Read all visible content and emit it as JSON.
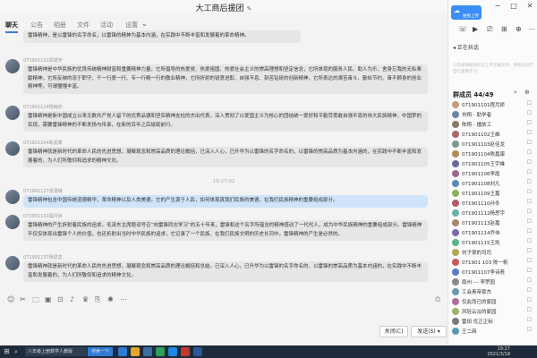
{
  "window": {
    "title": "大工商后援团",
    "edit_icon": "✎",
    "min": "—",
    "max": "□",
    "close": "✕"
  },
  "tabs": [
    {
      "label": "聊天",
      "active": true
    },
    {
      "label": "公告"
    },
    {
      "label": "相册"
    },
    {
      "label": "文件"
    },
    {
      "label": "活动"
    },
    {
      "label": "设置"
    }
  ],
  "tab_more": "⌄",
  "chat": {
    "top_partial": "雷锋精神，是以雷锋的名字命名，以雷锋的精神为基本内涵，在实践中不断丰富和发展着的革命精神。",
    "messages": [
      {
        "name": "071901132郑诺宇",
        "text": "雷锋精神是中华民族的优良传统精神财富和重要精神力量，它所倡导的热爱党、热爱祖国、热爱社会主义的崇高理想和坚定信念，它所体现的服务人民、助人为乐、舍身忘我的无私奉献精神，它所反映的忠于职守、干一行爱一行、专一行精一行的敬业精神，它所折射的锐意进取、自强不息、刻苦钻研的创新精神，它所表达的艰苦奋斗、勤俭节约、奋不顾身的创业精神等，可谓懂懂丰富。"
      },
      {
        "name": "071901124杨雨欣",
        "text": "雷锋精神是新中国成立以来无数共产党人留下的优秀品德和坚实精神支柱的杰出代表。深入贯彻了以爱国主义为核心的团结统一爱好和平勤劳勇敢自强不息的伟大民族精神，中国梦的实现，需要雷锋精神的不断发扬与传承，在新的百年之后砥砺前行。"
      },
      {
        "name": "071901104陈嘉康",
        "text": "雷锋精神就是新时代的革命人民的先进思想，凝聚观念和崇高品质的理论概括，已深入人心，已升华为以雷锋的名字命名的，以雷锋的崇高品质为基本内涵的，在实践中不断丰富和发展着的，为人们所敬仰和追求的精神文化。"
      }
    ],
    "timestamp": "19:27:02",
    "messages2": [
      {
        "name": "071901127张潇璐",
        "text": "雷锋精神包含中国传统道德精华，革命精神以及人类美德，它的产生源于人民，如何体现真我们民族的美德，在我们民族精神的重要组成部分。",
        "highlight": true
      },
      {
        "name": "071901101程月娇",
        "text": "雷锋精神的产生折射着民族的追求。毛泽东主席题词号召“向雷锋同志学习”的五十年来，雷锋和这个名字所蕴含的精神感动了一代代人，成为中华民族精神的重要组成部分。雷锋精神不仅仅体现出雷锋个人的价值，也还折射出当时中华民族的追求，它记录了一个民族、在我们民族文明的历史长河中，雷锋精神的产生是必然的。"
      },
      {
        "name": "071901137杨思蕊",
        "text": "雷锋精神就是新时代的革命人民的先进思想，凝聚观念和崇高品质的理论概括和总结。已深入人心，已升华为以雷锋的名字命名的，以雷锋的崇高品质为基本内涵的，在实践中不断丰富和发展着的，为人们所敬仰和追求的精神文化。"
      }
    ]
  },
  "toolbar": {
    "icons": [
      "smiley-icon",
      "scissors-icon",
      "folder-icon",
      "image-icon",
      "gift-icon",
      "mic-icon",
      "crown-icon",
      "screen-share-icon",
      "shake-icon",
      "more-icon"
    ],
    "glyphs": [
      "☺",
      "✂",
      "🗀",
      "▣",
      "⊡",
      "♪",
      "♛",
      "⎘",
      "✺",
      "⋯"
    ],
    "history": "⏲"
  },
  "buttons": {
    "close": "关闭(C)",
    "send": "发送(S)",
    "send_arrow": "▾"
  },
  "sidebar": {
    "upload_label": "拍照上传",
    "upload_icon": "☁",
    "top_icons": [
      "−",
      "□",
      "✕"
    ],
    "speaking": "正在共话",
    "notice": "七年级课程资料已上传至群文件，请各位同学自行查看学习",
    "members_title": "群成员 44/49",
    "members": [
      {
        "name": "071901101程月娇",
        "color": "#c79b7a"
      },
      {
        "name": "刘翔 - 助学者",
        "color": "#6b86a5"
      },
      {
        "name": "陈翔 - 播放工",
        "color": "#8a7a6a"
      },
      {
        "name": "071901102王维",
        "color": "#a56b6b"
      },
      {
        "name": "071901103赵佳龙",
        "color": "#7a9a8a"
      },
      {
        "name": "071901104陈嘉康",
        "color": "#b38a5a"
      },
      {
        "name": "071901105王宇峰",
        "color": "#6a6a9a"
      },
      {
        "name": "071901106李霞",
        "color": "#9a6a8a"
      },
      {
        "name": "071901108刘凡",
        "color": "#5a8ab3"
      },
      {
        "name": "071901109王嘉",
        "color": "#8ab35a"
      },
      {
        "name": "071901110孙冬",
        "color": "#b35a6a"
      },
      {
        "name": "071901112杨思宇",
        "color": "#6ab3a5"
      },
      {
        "name": "071901113赵嘉",
        "color": "#a58a6a"
      },
      {
        "name": "071901114乔伟",
        "color": "#7a6ab3"
      },
      {
        "name": "071901115王凯",
        "color": "#5ab38a"
      },
      {
        "name": "刘子豪的司司",
        "color": "#b3a55a"
      },
      {
        "name": "071901 103 陈一帆",
        "color": "#c55a5a"
      },
      {
        "name": "071901107李诗荟",
        "color": "#5a7ac5"
      },
      {
        "name": "扇州 --- 李罗园",
        "color": "#8a8a8a"
      },
      {
        "name": "工会奥帝豪杰",
        "color": "#6a9ab3"
      },
      {
        "name": "仅此而已的家园",
        "color": "#b36a9a"
      },
      {
        "name": "风轻云淡的家园",
        "color": "#9ab36a"
      },
      {
        "name": "雷田    优正正标",
        "color": "#7a7a7a"
      },
      {
        "name": "王二麻",
        "color": "#5a9ab3"
      }
    ]
  },
  "taskbar": {
    "start": "⊞",
    "search": "⌕",
    "task_label": "八年级上册数学人教版",
    "search_label": "搜索一下",
    "time": "19:27",
    "date": "2021/3/18"
  }
}
